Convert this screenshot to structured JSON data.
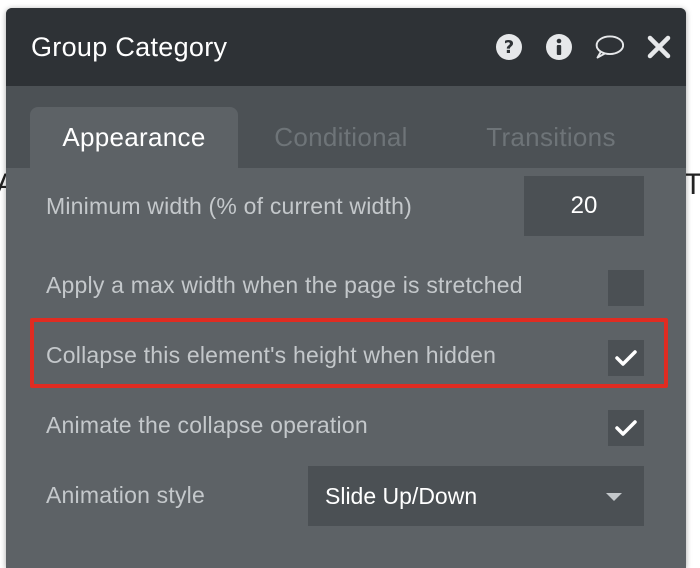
{
  "panel": {
    "title": "Group Category",
    "header_icons": [
      "help-icon",
      "info-icon",
      "comment-icon",
      "close-icon"
    ]
  },
  "tabs": [
    {
      "label": "Appearance",
      "active": true
    },
    {
      "label": "Conditional",
      "active": false
    },
    {
      "label": "Transitions",
      "active": false
    }
  ],
  "settings": {
    "min_width_label": "Minimum width (% of current width)",
    "min_width_value": "20",
    "max_width_label": "Apply a max width when the page is stretched",
    "max_width_checked": false,
    "collapse_label": "Collapse this element's height when hidden",
    "collapse_checked": true,
    "animate_label": "Animate the collapse operation",
    "animate_checked": true,
    "animation_style_label": "Animation style",
    "animation_style_value": "Slide Up/Down"
  },
  "colors": {
    "header_bg": "#2e3236",
    "panel_bg": "#5d6266",
    "tabbar_bg": "#4c5155",
    "input_bg": "#4b5054",
    "highlight": "#e02c22"
  }
}
